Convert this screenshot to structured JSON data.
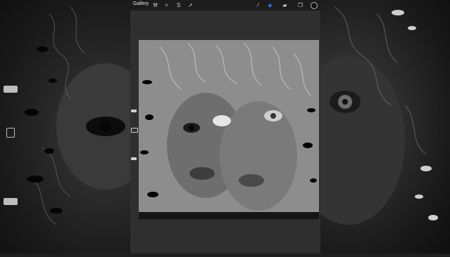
{
  "toolbar": {
    "gallery_label": "Gallery"
  },
  "tools": [
    "wrench-icon",
    "magic-wand-icon",
    "selection-icon",
    "arrow-icon",
    "brush-icon",
    "smudge-icon",
    "eraser-icon",
    "layers-icon",
    "color-icon"
  ],
  "colors": {
    "active_brush": "#2d6cdf",
    "toolbar": "#1c1c1c"
  }
}
